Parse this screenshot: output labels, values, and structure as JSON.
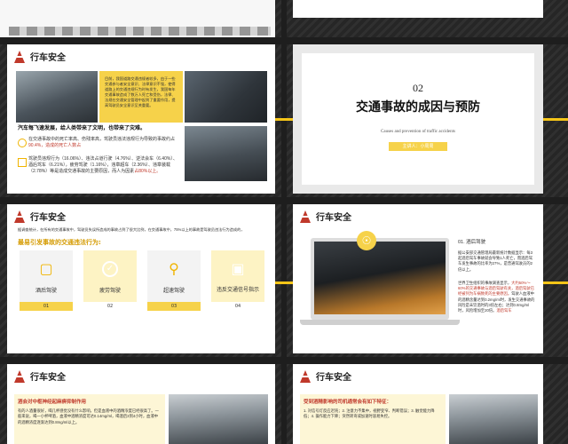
{
  "section_header": "行车安全",
  "slide2": {
    "box_text": "目前，我国道路交通违规者较多，由于一些交通参与者安全意识、法律意识不强，使得道路上的交通违规行为时有发生，我国每年交通事故造成了数万人死亡和受伤，法律、法规在交通安全管理中起到了重要作用，提高驾驶员安全意识至关重要。",
    "heading": "汽车每飞速发展，给人类带来了文明，也带来了灾难。",
    "p1": "在交通事故中的死亡率高、伤残率高，驾驶员违法违规行为导致的事故约占",
    "p1_red": "90.4%，造成的死亡人数占",
    "p2": "驾驶员违规行为（16.06%）、违法占道行驶（4.76%）、逆法会车（6.40%）、酒后驾车（6.21%），疲劳驾驶（1.16%），违章超车（2.36%）、违章装载（2.78%）等是造成交通事故的主要原因，而人为因素",
    "p2_red": "占80%以上。"
  },
  "slide3": {
    "number": "02",
    "title": "交通事故的成因与预防",
    "subtitle": "Causes and prevention of traffic accidents",
    "badge": "主讲人：小周周"
  },
  "slide4": {
    "intro": "据调查统计，在所有的交通事故中，驾驶员失误所造成的事故占到了很大比例，在交通事故中，75%以上的事故是驾驶员违法行为造成的，",
    "intro_red": "75%以上的事故是驾驶员违法行为导致的",
    "subheading": "最易引发事故的交通违法行为:",
    "cards": [
      {
        "label": "酒后驾驶",
        "num": "01",
        "icon": "chat-icon"
      },
      {
        "label": "疲劳驾驶",
        "num": "02",
        "icon": "clock-icon"
      },
      {
        "label": "超速驾驶",
        "num": "03",
        "icon": "search-icon"
      },
      {
        "label": "违反交通信号指示",
        "num": "04",
        "icon": "briefcase-icon"
      }
    ]
  },
  "slide5": {
    "item_title": "01. 酒后驾驶",
    "p1": "据公安部交通管理局最新统计数据显示：每3起酒后驾车事故就会导致1人死亡，而酒后驾车发生事故的比率为27%，是普通驾驶员的2倍以上。",
    "p2_a": "世界卫生组织的事故调查显示，",
    "p2_red1": "大约50%～60%的交通事故与酒后驾驶有关，酒后驾驶已经被列为车祸致死的主要原因。",
    "p2_b": "驾驶人血液中的酒精含量达到0.2mg/ml时，发生交通事故的风险是未饮酒时的3倍左右；达到0.8mg/ml时，风险增加至20倍。",
    "p2_red2": "酒后驾车"
  },
  "slide6": {
    "heading": "酒会对中枢神经起麻痹抑制作用",
    "body": "有的人酒量很好，喝几杯感觉没有什么影响，但是血液中的酒精浓度已经很高了。一般来说，喝一小杯啤酒，血液中酒精浓度可达0.14mg/ml，喝酒后3到4小时，血液中的酒精浓度逐渐达到0.8mg/ml以上。",
    "red": "3到4小时"
  },
  "slide7": {
    "heading": "受到酒精影响的司机通常会有如下特征：",
    "body": "1. 对信号灯反应迟钝；2. 注意力不集中，视野变窄、判断错误；3. 触觉能力降低；4. 操作能力下降；突然转弯或加速时容易失控。"
  }
}
